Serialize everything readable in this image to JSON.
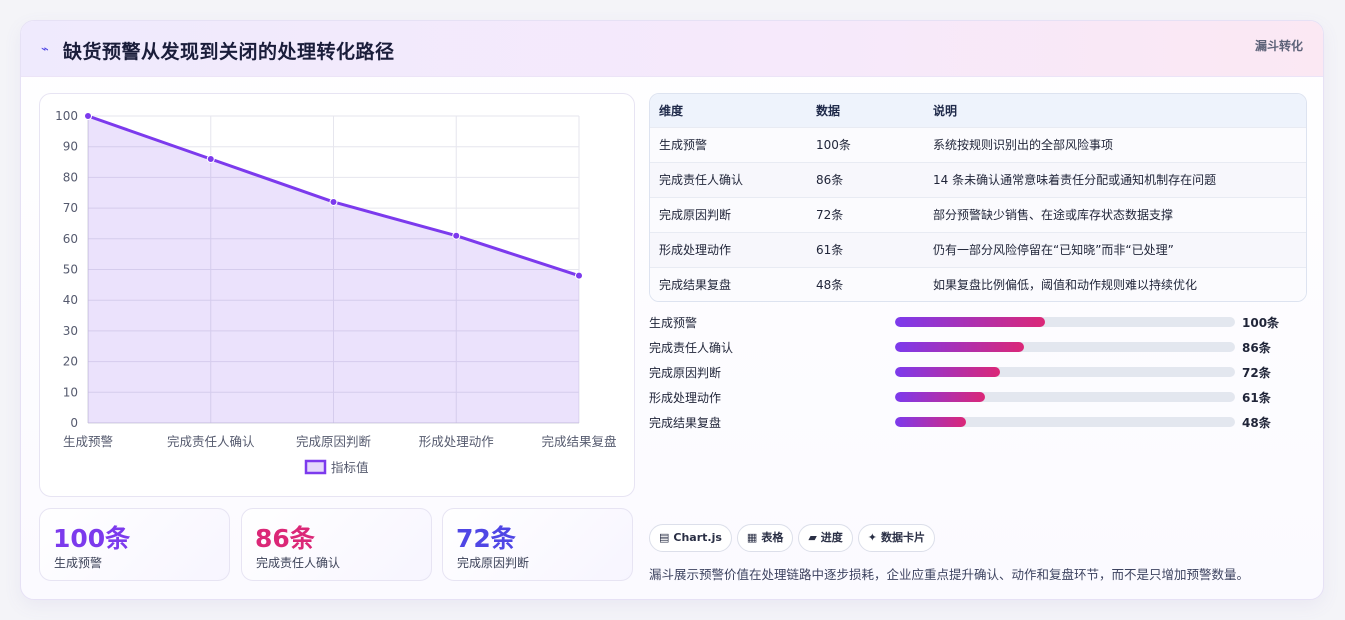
{
  "header": {
    "icon": "trend-arrow-icon",
    "title": "缺货预警从发现到关闭的处理转化路径",
    "tag": "漏斗转化"
  },
  "chart_data": {
    "type": "area",
    "categories": [
      "生成预警",
      "完成责任人确认",
      "完成原因判断",
      "形成处理动作",
      "完成结果复盘"
    ],
    "series": [
      {
        "name": "指标值",
        "values": [
          100,
          86,
          72,
          61,
          48
        ]
      }
    ],
    "ylim": [
      0,
      100
    ],
    "yticks": [
      0,
      10,
      20,
      30,
      40,
      50,
      60,
      70,
      80,
      90,
      100
    ],
    "grid": true,
    "legend": "bottom",
    "color": "#7c3aed"
  },
  "kpis": [
    {
      "value": "100条",
      "label": "生成预警",
      "color": "#7c3aed"
    },
    {
      "value": "86条",
      "label": "完成责任人确认",
      "color": "#db2777"
    },
    {
      "value": "72条",
      "label": "完成原因判断",
      "color": "#4f46e5"
    }
  ],
  "table": {
    "headers": [
      "维度",
      "数据",
      "说明"
    ],
    "rows": [
      [
        "生成预警",
        "100条",
        "系统按规则识别出的全部风险事项"
      ],
      [
        "完成责任人确认",
        "86条",
        "14 条未确认通常意味着责任分配或通知机制存在问题"
      ],
      [
        "完成原因判断",
        "72条",
        "部分预警缺少销售、在途或库存状态数据支撑"
      ],
      [
        "形成处理动作",
        "61条",
        "仍有一部分风险停留在“已知晓”而非“已处理”"
      ],
      [
        "完成结果复盘",
        "48条",
        "如果复盘比例偏低，阈值和动作规则难以持续优化"
      ]
    ]
  },
  "progress": [
    {
      "label": "生成预警",
      "value": "100条",
      "fraction": 0.44
    },
    {
      "label": "完成责任人确认",
      "value": "86条",
      "fraction": 0.38
    },
    {
      "label": "完成原因判断",
      "value": "72条",
      "fraction": 0.31
    },
    {
      "label": "形成处理动作",
      "value": "61条",
      "fraction": 0.265
    },
    {
      "label": "完成结果复盘",
      "value": "48条",
      "fraction": 0.21
    }
  ],
  "chips": [
    {
      "icon": "chart-icon",
      "glyph": "▤",
      "label": "Chart.js"
    },
    {
      "icon": "table-icon",
      "glyph": "▦",
      "label": "表格"
    },
    {
      "icon": "progress-icon",
      "glyph": "▰",
      "label": "进度"
    },
    {
      "icon": "card-icon",
      "glyph": "✦",
      "label": "数据卡片"
    }
  ],
  "footnote": "漏斗展示预警价值在处理链路中逐步损耗，企业应重点提升确认、动作和复盘环节，而不是只增加预警数量。"
}
